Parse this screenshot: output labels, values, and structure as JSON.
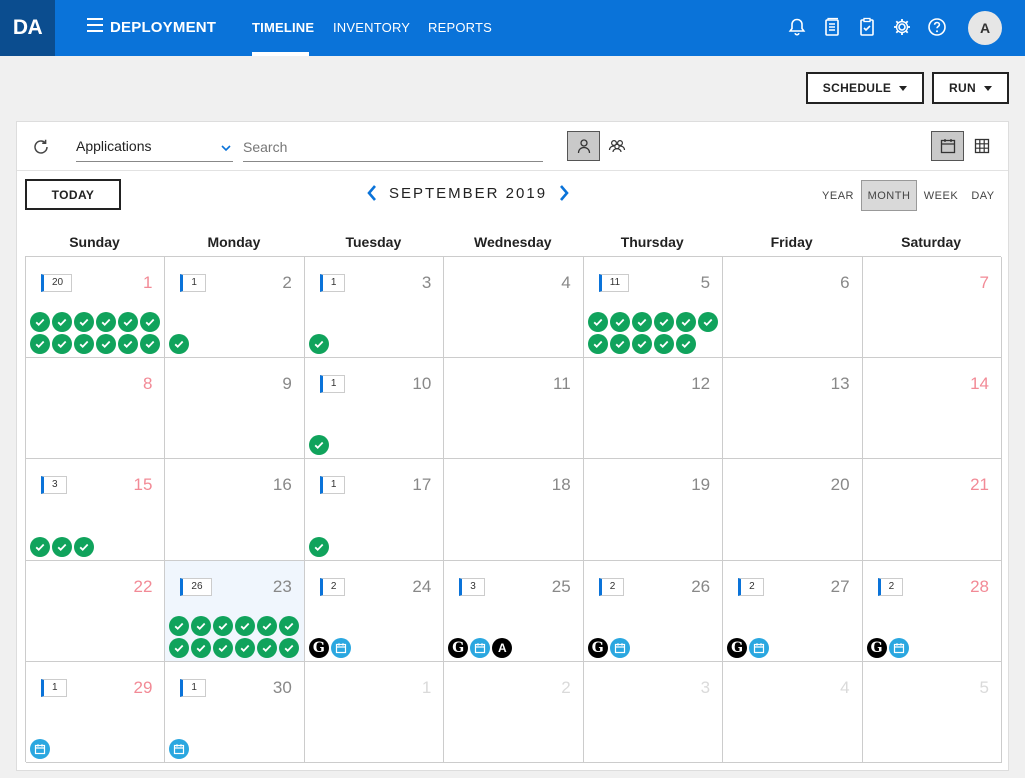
{
  "header": {
    "logo": "DA",
    "app_name": "DEPLOYMENT",
    "tabs": [
      {
        "label": "TIMELINE",
        "active": true
      },
      {
        "label": "INVENTORY",
        "active": false
      },
      {
        "label": "REPORTS",
        "active": false
      }
    ],
    "icons": [
      "bell-icon",
      "document-icon",
      "clipboard-check-icon",
      "gear-icon",
      "help-icon"
    ],
    "avatar_initial": "A",
    "color": "#0a73d9"
  },
  "actions": {
    "schedule_label": "SCHEDULE",
    "run_label": "RUN"
  },
  "toolbar": {
    "filter_value": "Applications",
    "search_placeholder": "Search",
    "user_view_icons": [
      "single-user-icon",
      "group-users-icon"
    ],
    "layout_icons": [
      "calendar-icon",
      "grid-icon"
    ]
  },
  "calendar": {
    "today_label": "TODAY",
    "month_title": "SEPTEMBER 2019",
    "views": [
      {
        "label": "YEAR",
        "selected": false
      },
      {
        "label": "MONTH",
        "selected": true
      },
      {
        "label": "WEEK",
        "selected": false
      },
      {
        "label": "DAY",
        "selected": false
      }
    ],
    "weekdays": [
      "Sunday",
      "Monday",
      "Tuesday",
      "Wednesday",
      "Thursday",
      "Friday",
      "Saturday"
    ],
    "days": [
      {
        "day": "1",
        "count": "20",
        "icons": [
          "check",
          "check",
          "check",
          "check",
          "check",
          "check",
          "check",
          "check",
          "check",
          "check",
          "check",
          "check"
        ]
      },
      {
        "day": "2",
        "count": "1",
        "icons": [
          "check"
        ]
      },
      {
        "day": "3",
        "count": "1",
        "icons": [
          "check"
        ]
      },
      {
        "day": "4",
        "count": "",
        "icons": []
      },
      {
        "day": "5",
        "count": "11",
        "icons": [
          "check",
          "check",
          "check",
          "check",
          "check",
          "check",
          "check",
          "check",
          "check",
          "check",
          "check"
        ]
      },
      {
        "day": "6",
        "count": "",
        "icons": []
      },
      {
        "day": "7",
        "count": "",
        "icons": []
      },
      {
        "day": "8",
        "count": "",
        "icons": []
      },
      {
        "day": "9",
        "count": "",
        "icons": []
      },
      {
        "day": "10",
        "count": "1",
        "icons": [
          "check"
        ]
      },
      {
        "day": "11",
        "count": "",
        "icons": []
      },
      {
        "day": "12",
        "count": "",
        "icons": []
      },
      {
        "day": "13",
        "count": "",
        "icons": []
      },
      {
        "day": "14",
        "count": "",
        "icons": []
      },
      {
        "day": "15",
        "count": "3",
        "icons": [
          "check",
          "check",
          "check"
        ]
      },
      {
        "day": "16",
        "count": "",
        "icons": []
      },
      {
        "day": "17",
        "count": "1",
        "icons": [
          "check"
        ]
      },
      {
        "day": "18",
        "count": "",
        "icons": []
      },
      {
        "day": "19",
        "count": "",
        "icons": []
      },
      {
        "day": "20",
        "count": "",
        "icons": []
      },
      {
        "day": "21",
        "count": "",
        "icons": []
      },
      {
        "day": "22",
        "count": "",
        "icons": []
      },
      {
        "day": "23",
        "count": "26",
        "highlight": true,
        "icons": [
          "check",
          "check",
          "check",
          "check",
          "check",
          "check",
          "check",
          "check",
          "check",
          "check",
          "check",
          "check"
        ]
      },
      {
        "day": "24",
        "count": "2",
        "icons": [
          "g",
          "cal"
        ]
      },
      {
        "day": "25",
        "count": "3",
        "icons": [
          "g",
          "cal",
          "a"
        ]
      },
      {
        "day": "26",
        "count": "2",
        "icons": [
          "g",
          "cal"
        ]
      },
      {
        "day": "27",
        "count": "2",
        "icons": [
          "g",
          "cal"
        ]
      },
      {
        "day": "28",
        "count": "2",
        "icons": [
          "g",
          "cal"
        ]
      },
      {
        "day": "29",
        "count": "1",
        "icons": [
          "cal"
        ]
      },
      {
        "day": "30",
        "count": "1",
        "icons": [
          "cal"
        ]
      },
      {
        "day": "1",
        "count": "",
        "other": true,
        "icons": []
      },
      {
        "day": "2",
        "count": "",
        "other": true,
        "icons": []
      },
      {
        "day": "3",
        "count": "",
        "other": true,
        "icons": []
      },
      {
        "day": "4",
        "count": "",
        "other": true,
        "icons": []
      },
      {
        "day": "5",
        "count": "",
        "other": true,
        "icons": []
      }
    ],
    "icon_letters": {
      "g": "G",
      "a": "A"
    },
    "colors": {
      "check": "#10a35c",
      "calendar": "#2aa7e0",
      "weekend": "#f28a96"
    }
  }
}
